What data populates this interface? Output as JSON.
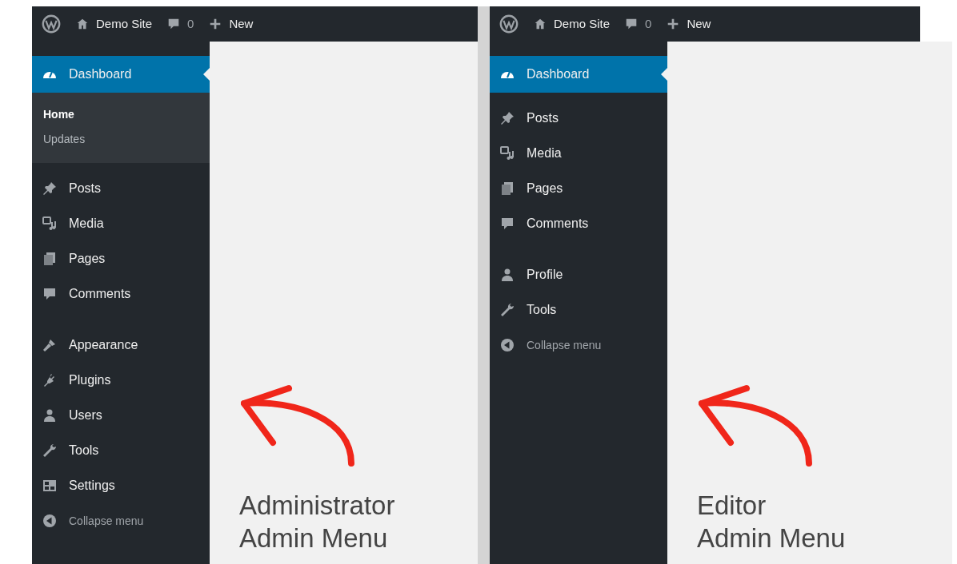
{
  "panels": [
    {
      "toolbar": {
        "site_name": "Demo Site",
        "comment_count": "0",
        "new_label": "New"
      },
      "menu_groups": [
        [
          {
            "kind": "dashboard",
            "label": "Dashboard",
            "selected": true,
            "children": [
              {
                "label": "Home",
                "selected": true
              },
              {
                "label": "Updates",
                "selected": false
              }
            ]
          }
        ],
        [
          {
            "kind": "posts",
            "label": "Posts",
            "selected": false
          },
          {
            "kind": "media",
            "label": "Media",
            "selected": false
          },
          {
            "kind": "pages",
            "label": "Pages",
            "selected": false
          },
          {
            "kind": "comments",
            "label": "Comments",
            "selected": false
          }
        ],
        [
          {
            "kind": "appearance",
            "label": "Appearance",
            "selected": false
          },
          {
            "kind": "plugins",
            "label": "Plugins",
            "selected": false
          },
          {
            "kind": "users",
            "label": "Users",
            "selected": false
          },
          {
            "kind": "tools",
            "label": "Tools",
            "selected": false
          },
          {
            "kind": "settings",
            "label": "Settings",
            "selected": false
          },
          {
            "kind": "collapse",
            "label": "Collapse menu",
            "selected": false
          }
        ]
      ],
      "caption_lines": [
        "Administrator",
        "Admin Menu"
      ]
    },
    {
      "toolbar": {
        "site_name": "Demo Site",
        "comment_count": "0",
        "new_label": "New"
      },
      "menu_groups": [
        [
          {
            "kind": "dashboard",
            "label": "Dashboard",
            "selected": true
          }
        ],
        [
          {
            "kind": "posts",
            "label": "Posts",
            "selected": false
          },
          {
            "kind": "media",
            "label": "Media",
            "selected": false
          },
          {
            "kind": "pages",
            "label": "Pages",
            "selected": false
          },
          {
            "kind": "comments",
            "label": "Comments",
            "selected": false
          }
        ],
        [
          {
            "kind": "users",
            "label": "Profile",
            "selected": false
          },
          {
            "kind": "tools",
            "label": "Tools",
            "selected": false
          },
          {
            "kind": "collapse",
            "label": "Collapse menu",
            "selected": false
          }
        ]
      ],
      "caption_lines": [
        "Editor",
        "Admin Menu"
      ]
    }
  ]
}
